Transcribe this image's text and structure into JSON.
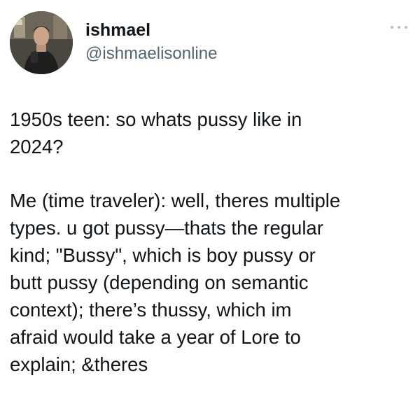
{
  "author": {
    "display_name": "ishmael",
    "handle": "@ishmaelisonline"
  },
  "icons": {
    "more": "more-horizontal-icon",
    "avatar": "profile-photo"
  },
  "tweet": {
    "paragraphs": [
      "1950s teen: so whats pussy like in\n2024?",
      "Me (time traveler): well, theres multiple\ntypes. u got pussy—thats the regular\nkind; \"Bussy\", which is boy pussy or\nbutt pussy (depending on semantic\ncontext); there’s thussy, which im\nafraid would take a year of Lore to\nexplain; &theres"
    ]
  }
}
